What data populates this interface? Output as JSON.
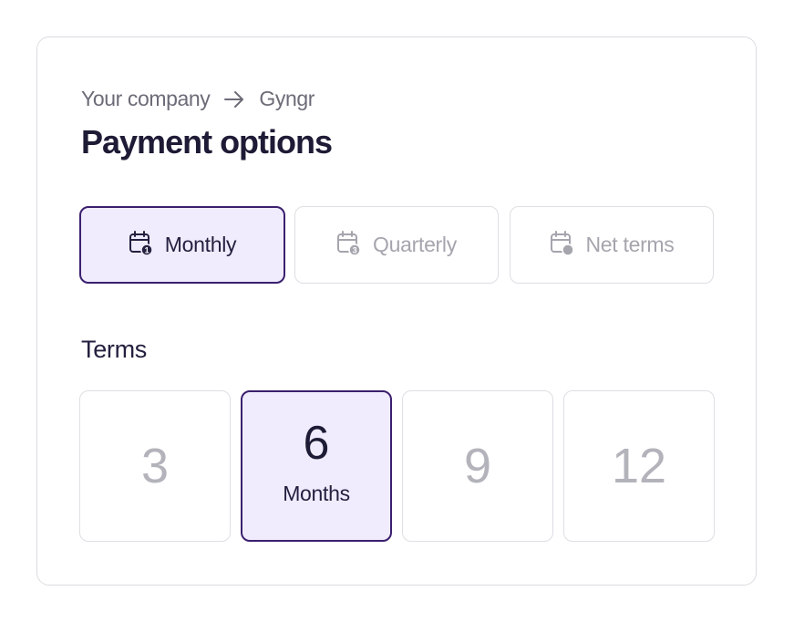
{
  "breadcrumb": {
    "from": "Your company",
    "to": "Gyngr"
  },
  "title": "Payment options",
  "payment_options": [
    {
      "label": "Monthly",
      "icon": "calendar-1-icon",
      "selected": true
    },
    {
      "label": "Quarterly",
      "icon": "calendar-3-icon",
      "selected": false
    },
    {
      "label": "Net terms",
      "icon": "calendar-dot-icon",
      "selected": false
    }
  ],
  "terms": {
    "label": "Terms",
    "options": [
      {
        "value": "3",
        "selected": false
      },
      {
        "value": "6",
        "unit": "Months",
        "selected": true
      },
      {
        "value": "9",
        "selected": false
      },
      {
        "value": "12",
        "selected": false
      }
    ]
  },
  "colors": {
    "accent": "#3b1f6e",
    "selected_bg": "#f0ecfd",
    "muted_text": "#a5a5ae"
  }
}
